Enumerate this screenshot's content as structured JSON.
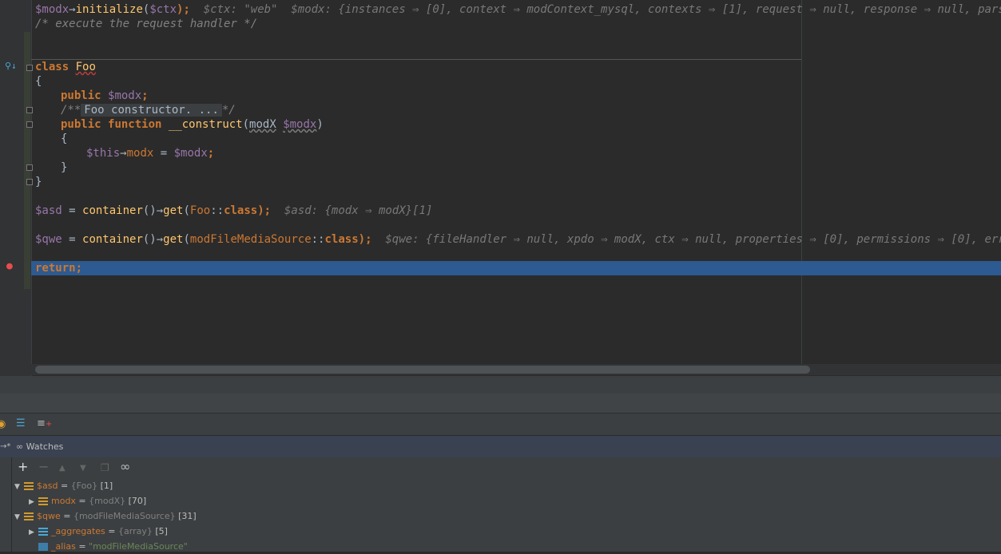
{
  "code": {
    "line1": {
      "a": "$modx",
      "b": "→",
      "c": "initialize",
      "d": "(",
      "e": "$ctx",
      "f": ");",
      "g": "  $ctx: \"web\"  $modx: {instances ⇒ [0], context ⇒ modContext_mysql, contexts ⇒ [1], request ⇒ null, response ⇒ null, parse"
    },
    "line2": "/* execute the request handler */",
    "line3": {
      "kw": "class",
      "name": "Foo"
    },
    "line4": "{",
    "line5": {
      "kw": "public",
      "var": "$modx",
      "end": ";"
    },
    "line6": {
      "open": "/**",
      "fold": "Foo constructor. ...",
      "close": "*/"
    },
    "line7": {
      "kw1": "public",
      "kw2": "function",
      "fn": "__construct",
      "p1": "(",
      "type": "modX",
      "var": "$modx",
      "p2": ")"
    },
    "line8": "{",
    "line9": {
      "v1": "$this",
      "arrow": "→",
      "prop": "modx",
      "eq": " = ",
      "v2": "$modx",
      "end": ";"
    },
    "line10": "}",
    "line11": "}",
    "line12": {
      "v": "$asd",
      "eq": " = ",
      "fn1": "container",
      "p": "()",
      "arrow": "→",
      "fn2": "get",
      "o": "(",
      "cls": "Foo",
      "dc": "::",
      "kw": "class",
      "c": ");",
      "inline": "  $asd: {modx ⇒ modX}[1]"
    },
    "line13": {
      "v": "$qwe",
      "eq": " = ",
      "fn1": "container",
      "p": "()",
      "arrow": "→",
      "fn2": "get",
      "o": "(",
      "cls": "modFileMediaSource",
      "dc": "::",
      "kw": "class",
      "c": ");",
      "inline": "  $qwe: {fileHandler ⇒ null, xpdo ⇒ modX, ctx ⇒ null, properties ⇒ [0], permissions ⇒ [0], erro"
    },
    "line14": {
      "kw": "return",
      "end": ";"
    }
  },
  "watches": {
    "title": "Watches",
    "rows": [
      {
        "name": "$asd",
        "eq": " = ",
        "type": "{Foo}",
        "count": " [1]"
      },
      {
        "name": "modx",
        "eq": " = ",
        "type": "{modX}",
        "count": " [70]"
      },
      {
        "name": "$qwe",
        "eq": " = ",
        "type": "{modFileMediaSource}",
        "count": " [31]"
      },
      {
        "name": "_aggregates",
        "eq": " = ",
        "type": "{array}",
        "count": " [5]"
      },
      {
        "name": "_alias",
        "eq": " = ",
        "value": "\"modFileMediaSource\""
      }
    ]
  },
  "toolbar": {
    "add": "+",
    "remove": "−",
    "up": "▲",
    "down": "▼",
    "copy": "❐",
    "glasses": "∞"
  },
  "colors": {
    "keyword": "#cc7832",
    "variable": "#9876aa",
    "function": "#ffc66d",
    "comment": "#808080",
    "execution": "#2d5a91"
  }
}
